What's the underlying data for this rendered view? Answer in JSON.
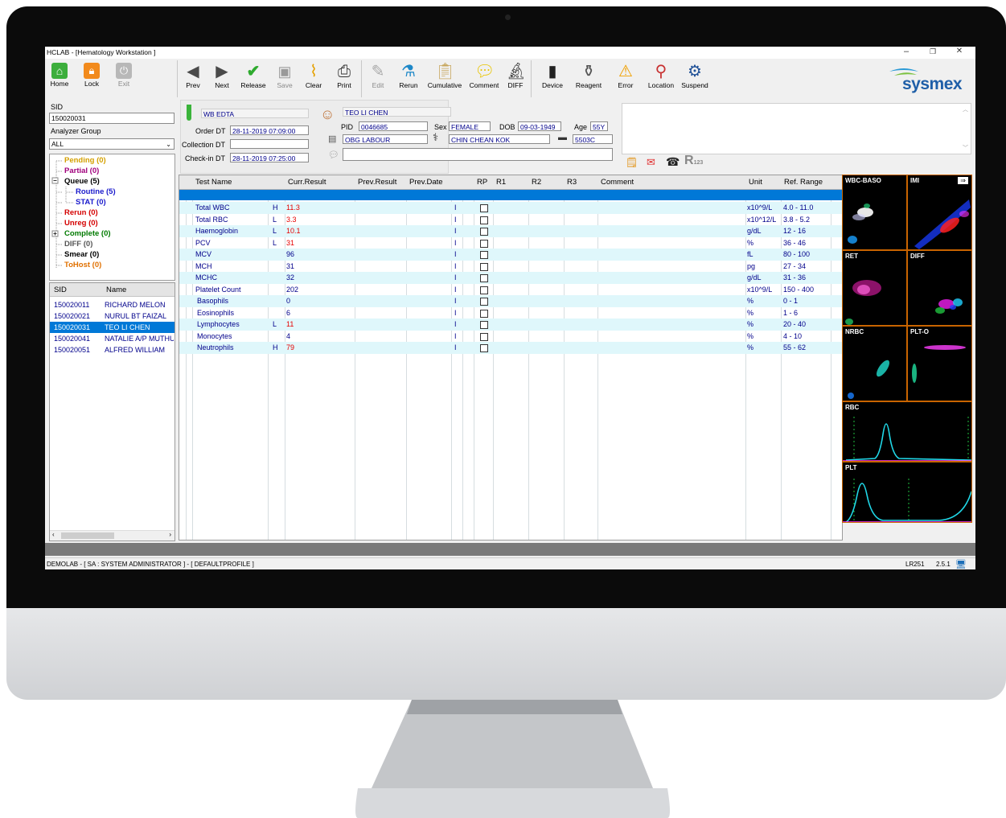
{
  "window": {
    "title": "HCLAB - [Hematology Workstation ]",
    "minimize": "–",
    "restore": "❐",
    "close": "✕"
  },
  "toolbar": {
    "buttons": [
      {
        "label": "Home",
        "icon": "home-icon"
      },
      {
        "label": "Lock",
        "icon": "lock-icon"
      },
      {
        "label": "Exit",
        "icon": "power-icon"
      },
      {
        "label": "Prev",
        "icon": "arrow-left-icon"
      },
      {
        "label": "Next",
        "icon": "arrow-right-icon"
      },
      {
        "label": "Release",
        "icon": "checkmark-icon"
      },
      {
        "label": "Save",
        "icon": "floppy-icon"
      },
      {
        "label": "Clear",
        "icon": "broom-icon"
      },
      {
        "label": "Print",
        "icon": "printer-icon"
      },
      {
        "label": "Edit",
        "icon": "pencil-icon"
      },
      {
        "label": "Rerun",
        "icon": "flask-icon"
      },
      {
        "label": "Cumulative",
        "icon": "clipboard-icon"
      },
      {
        "label": "Comment",
        "icon": "speech-bubble-icon"
      },
      {
        "label": "DIFF",
        "icon": "microscope-icon"
      },
      {
        "label": "Device",
        "icon": "device-icon"
      },
      {
        "label": "Reagent",
        "icon": "reagent-bottle-icon"
      },
      {
        "label": "Error",
        "icon": "warning-icon"
      },
      {
        "label": "Location",
        "icon": "location-icon"
      },
      {
        "label": "Suspend",
        "icon": "gear-stop-icon"
      }
    ],
    "brand": "sysmex"
  },
  "left": {
    "sid_label": "SID",
    "sid_value": "150020031",
    "group_label": "Analyzer Group",
    "group_value": "ALL",
    "tree": [
      {
        "label": "Pending (0)",
        "color": "#d4a000"
      },
      {
        "label": "Partial (0)",
        "color": "#a0007c"
      },
      {
        "label": "Queue (5)",
        "color": "#000000"
      },
      {
        "label": "Routine (5)",
        "color": "#1a1acc"
      },
      {
        "label": "STAT (0)",
        "color": "#1a1acc"
      },
      {
        "label": "Rerun (0)",
        "color": "#d40000"
      },
      {
        "label": "Unreg (0)",
        "color": "#d40000"
      },
      {
        "label": "Complete (0)",
        "color": "#007a00"
      },
      {
        "label": "DIFF (0)",
        "color": "#555555"
      },
      {
        "label": "Smear (0)",
        "color": "#000000"
      },
      {
        "label": "ToHost (0)",
        "color": "#e07000"
      }
    ],
    "list_headers": {
      "sid": "SID",
      "name": "Name"
    },
    "samples": [
      {
        "sid": "150020011",
        "name": "RICHARD MELON"
      },
      {
        "sid": "150020021",
        "name": "NURUL BT FAIZAL"
      },
      {
        "sid": "150020031",
        "name": "TEO LI CHEN"
      },
      {
        "sid": "150020041",
        "name": "NATALIE A/P MUTHU"
      },
      {
        "sid": "150020051",
        "name": "ALFRED WILLIAM"
      }
    ]
  },
  "sample": {
    "specimen": "WB EDTA",
    "order_dt_label": "Order DT",
    "order_dt": "28-11-2019 07:09:00",
    "collection_dt_label": "Collection DT",
    "collection_dt": "",
    "checkin_dt_label": "Check-in DT",
    "checkin_dt": "28-11-2019 07:25:00"
  },
  "patient": {
    "name": "TEO LI CHEN",
    "pid_label": "PID",
    "pid": "0046685",
    "sex_label": "Sex",
    "sex": "FEMALE",
    "dob_label": "DOB",
    "dob": "09-03-1949",
    "age_label": "Age",
    "age": "55Y",
    "ward": "OBG LABOUR",
    "doctor": "CHIN CHEAN KOK",
    "bed": "5503C",
    "r123": "R"
  },
  "grid": {
    "headers": {
      "test": "Test Name",
      "curr": "Curr.Result",
      "prev": "Prev.Result",
      "prevdate": "Prev.Date",
      "rp": "RP",
      "r1": "R1",
      "r2": "R2",
      "r3": "R3",
      "comment": "Comment",
      "unit": "Unit",
      "ref": "Ref. Range"
    },
    "rows": [
      {
        "test": "Total WBC",
        "flag": "H",
        "result": "11.3",
        "mark": "I",
        "unit": "x10^9/L",
        "ref": "4.0 - 11.0"
      },
      {
        "test": "Total RBC",
        "flag": "L",
        "result": "3.3",
        "mark": "I",
        "unit": "x10^12/L",
        "ref": "3.8 - 5.2"
      },
      {
        "test": "Haemoglobin",
        "flag": "L",
        "result": "10.1",
        "mark": "I",
        "unit": "g/dL",
        "ref": "12 - 16"
      },
      {
        "test": "PCV",
        "flag": "L",
        "result": "31",
        "mark": "I",
        "unit": "%",
        "ref": "36 - 46"
      },
      {
        "test": "MCV",
        "flag": "",
        "result": "96",
        "mark": "I",
        "unit": "fL",
        "ref": "80 - 100"
      },
      {
        "test": "MCH",
        "flag": "",
        "result": "31",
        "mark": "I",
        "unit": "pg",
        "ref": "27 - 34"
      },
      {
        "test": "MCHC",
        "flag": "",
        "result": "32",
        "mark": "I",
        "unit": "g/dL",
        "ref": "31 - 36"
      },
      {
        "test": "Platelet Count",
        "flag": "",
        "result": "202",
        "mark": "I",
        "unit": "x10^9/L",
        "ref": "150 - 400"
      },
      {
        "test": "Basophils",
        "flag": "",
        "result": "0",
        "mark": "I",
        "unit": "%",
        "ref": "0 - 1"
      },
      {
        "test": "Eosinophils",
        "flag": "",
        "result": "6",
        "mark": "I",
        "unit": "%",
        "ref": "1 - 6"
      },
      {
        "test": "Lymphocytes",
        "flag": "L",
        "result": "11",
        "mark": "I",
        "unit": "%",
        "ref": "20 - 40"
      },
      {
        "test": "Monocytes",
        "flag": "",
        "result": "4",
        "mark": "I",
        "unit": "%",
        "ref": "4 - 10"
      },
      {
        "test": "Neutrophils",
        "flag": "H",
        "result": "79",
        "mark": "I",
        "unit": "%",
        "ref": "55 - 62"
      }
    ]
  },
  "plots": {
    "wbc_baso": "WBC-BASO",
    "imi": "IMI",
    "ret": "RET",
    "diff": "DIFF",
    "nrbc": "NRBC",
    "plto": "PLT-O",
    "rbc": "RBC",
    "plt": "PLT",
    "expand": "⇒"
  },
  "status": {
    "left": "DEMOLAB - [ SA : SYSTEM ADMINISTRATOR ] - [ DEFAULTPROFILE ]",
    "station": "LR251",
    "version": "2.5.1"
  }
}
